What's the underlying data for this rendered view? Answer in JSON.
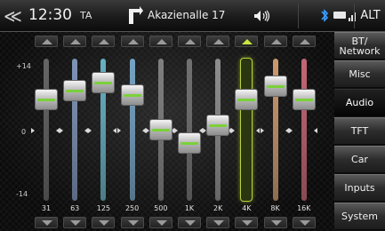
{
  "topbar": {
    "back_symbol": "≪",
    "time": "12:30",
    "ta": "TA",
    "street": "Akazienalle 17",
    "alt": "ALT",
    "icons": [
      "back-icon",
      "turn-arrow-icon",
      "speaker-icon",
      "bluetooth-icon",
      "battery-icon",
      "signal-icon"
    ]
  },
  "eq": {
    "scale_top": "+14",
    "scale_mid": "0",
    "scale_bottom": "-14",
    "range_db": [
      -14,
      14
    ],
    "bands": [
      {
        "label": "31",
        "value_db": 7,
        "track_color": "#6e6e6e",
        "selected": false
      },
      {
        "label": "63",
        "value_db": 9,
        "track_color": "#8aa2c8",
        "selected": false
      },
      {
        "label": "125",
        "value_db": 11,
        "track_color": "#6ec0d4",
        "selected": false
      },
      {
        "label": "250",
        "value_db": 8,
        "track_color": "#7fb2d6",
        "selected": false
      },
      {
        "label": "500",
        "value_db": 0,
        "track_color": "#8a8a8a",
        "selected": false
      },
      {
        "label": "1K",
        "value_db": -3,
        "track_color": "#7a7a7a",
        "selected": false
      },
      {
        "label": "2K",
        "value_db": 1,
        "track_color": "#9a9a9a",
        "selected": false
      },
      {
        "label": "4K",
        "value_db": 7,
        "track_color": "#c8e640",
        "selected": true
      },
      {
        "label": "8K",
        "value_db": 10,
        "track_color": "#e0a878",
        "selected": false
      },
      {
        "label": "16K",
        "value_db": 7,
        "track_color": "#d87080",
        "selected": false
      }
    ]
  },
  "menu": {
    "items": [
      {
        "label": "BT/\nNetwork",
        "line1": "BT/",
        "line2": "Network",
        "active": false
      },
      {
        "label": "Misc",
        "active": false
      },
      {
        "label": "Audio",
        "active": true
      },
      {
        "label": "TFT",
        "active": false
      },
      {
        "label": "Car",
        "active": false
      },
      {
        "label": "Inputs",
        "active": false
      },
      {
        "label": "System",
        "active": false
      }
    ]
  },
  "colors": {
    "accent": "#c8e640",
    "knob_indicator": "#7ad13a"
  }
}
